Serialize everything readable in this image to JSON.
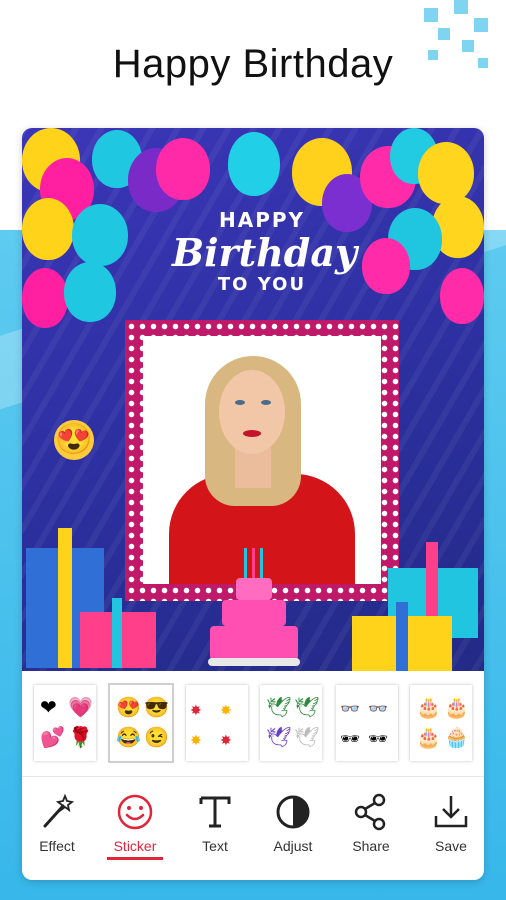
{
  "header": {
    "title": "Happy Birthday"
  },
  "canvas": {
    "greeting_top": "HAPPY",
    "greeting_main": "Birthday",
    "greeting_bottom": "TO YOU"
  },
  "stickers": {
    "selected_index": 1,
    "packs": [
      "hearts-pack",
      "emoji-pack",
      "comic-words-pack",
      "birds-pack",
      "glasses-pack",
      "cakes-pack"
    ]
  },
  "toolbar": {
    "items": [
      {
        "label": "Effect",
        "icon": "magic-wand-icon"
      },
      {
        "label": "Sticker",
        "icon": "smiley-icon"
      },
      {
        "label": "Text",
        "icon": "text-t-icon"
      },
      {
        "label": "Adjust",
        "icon": "contrast-icon"
      },
      {
        "label": "Share",
        "icon": "share-icon"
      },
      {
        "label": "Save",
        "icon": "download-icon"
      }
    ],
    "active_index": 1
  },
  "colors": {
    "accent": "#e0243a",
    "background": "#37b7ea",
    "canvas": "#2a2f9c",
    "frame": "#c0196a"
  }
}
